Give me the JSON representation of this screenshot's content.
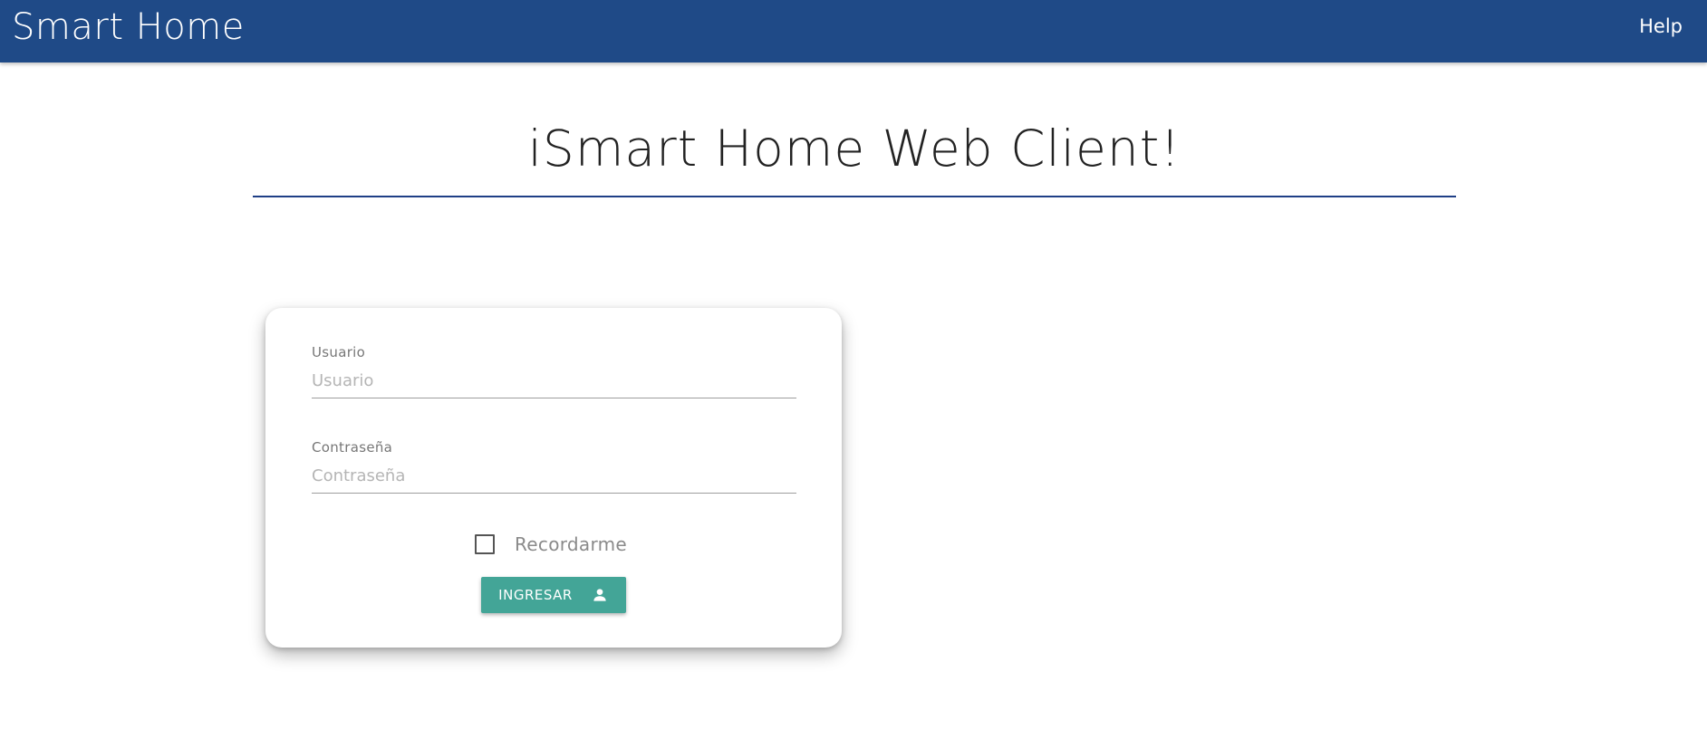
{
  "navbar": {
    "brand": "Smart Home",
    "help_label": "Help",
    "color": "#1f4a87"
  },
  "heading": {
    "title": "iSmart Home Web Client!",
    "divider_color": "#1f3f86"
  },
  "login_form": {
    "username": {
      "label": "Usuario",
      "placeholder": "Usuario",
      "value": ""
    },
    "password": {
      "label": "Contraseña",
      "placeholder": "Contraseña",
      "value": ""
    },
    "remember": {
      "label": "Recordarme",
      "checked": false
    },
    "submit": {
      "label": "INGRESAR",
      "icon": "person-icon",
      "color": "#43a597"
    }
  }
}
